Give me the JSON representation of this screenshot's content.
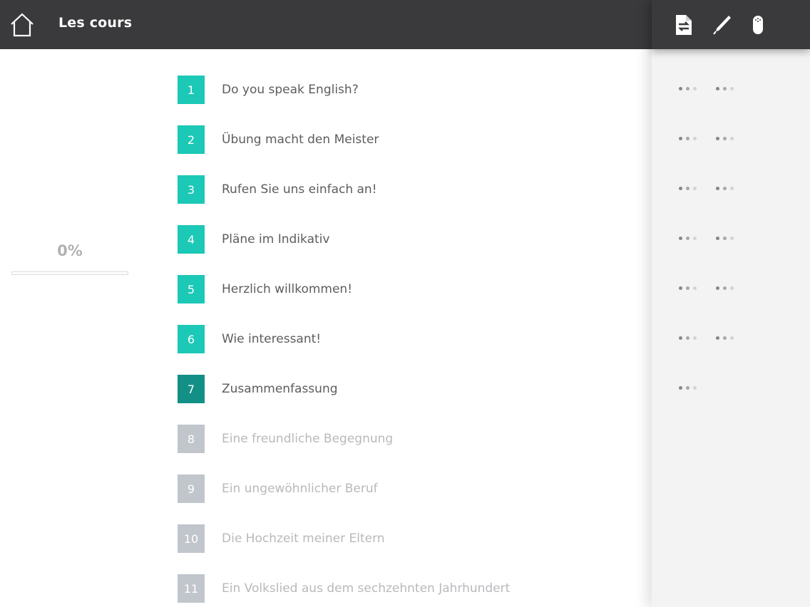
{
  "header": {
    "title": "Les cours",
    "home_icon": "home-icon"
  },
  "toolbar": {
    "icons": [
      "notes-switch-icon",
      "pen-icon",
      "microphone-icon"
    ]
  },
  "progress": {
    "label": "0%",
    "fraction": 0.0
  },
  "lessons": [
    {
      "number": "1",
      "title": "Do you speak English?",
      "state": "done"
    },
    {
      "number": "2",
      "title": "Übung macht den Meister",
      "state": "done"
    },
    {
      "number": "3",
      "title": "Rufen Sie uns einfach an!",
      "state": "done"
    },
    {
      "number": "4",
      "title": "Pläne im Indikativ",
      "state": "done"
    },
    {
      "number": "5",
      "title": "Herzlich willkommen!",
      "state": "done"
    },
    {
      "number": "6",
      "title": "Wie interessant!",
      "state": "done"
    },
    {
      "number": "7",
      "title": "Zusammenfassung",
      "state": "current"
    },
    {
      "number": "8",
      "title": "Eine freundliche Begegnung",
      "state": "locked"
    },
    {
      "number": "9",
      "title": "Ein ungewöhnlicher Beruf",
      "state": "locked"
    },
    {
      "number": "10",
      "title": "Die Hochzeit meiner Eltern",
      "state": "locked"
    },
    {
      "number": "11",
      "title": "Ein Volkslied aus dem sechzehnten Jahrhundert",
      "state": "locked"
    }
  ],
  "score_dot_groups": [
    2,
    2,
    2,
    2,
    2,
    2,
    1
  ],
  "colors": {
    "header_bg": "#3a393b",
    "done": "#1cc8b6",
    "current": "#129085",
    "locked": "#c1c5cc"
  }
}
